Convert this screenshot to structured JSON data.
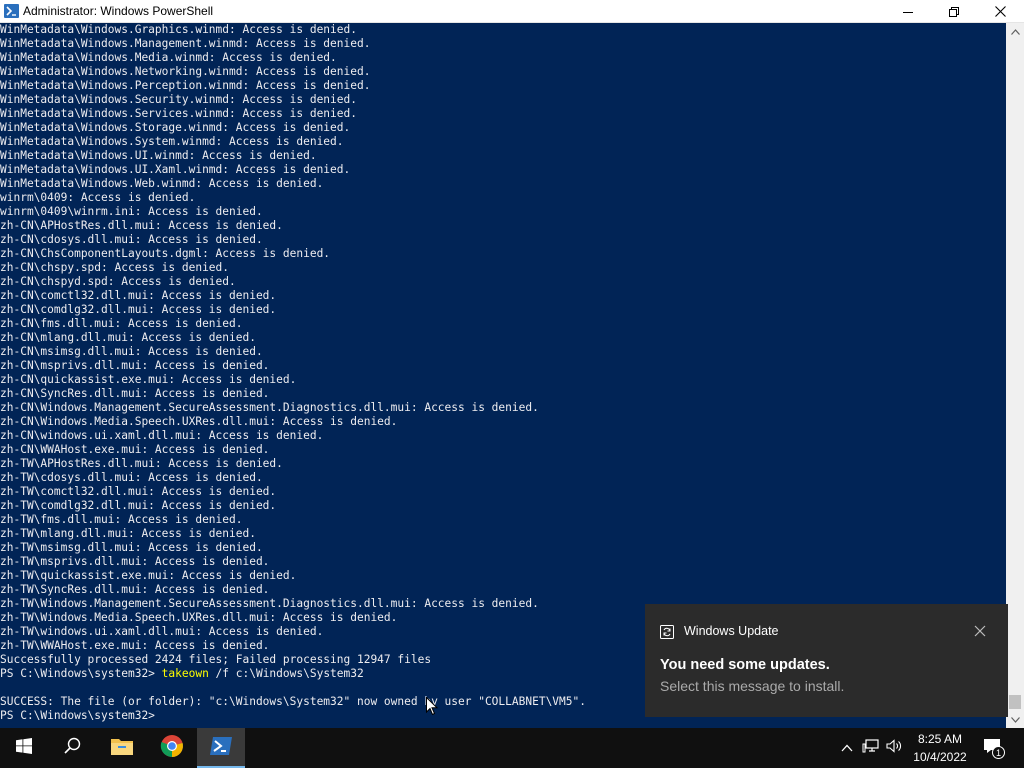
{
  "window": {
    "title": "Administrator: Windows PowerShell",
    "minimize_icon": "minimize-icon",
    "maximize_icon": "restore-icon",
    "close_icon": "close-icon"
  },
  "console": {
    "background": "#012456",
    "text_color": "#eeedf0",
    "command_color": "#ffff00",
    "lines": [
      "WinMetadata\\Windows.Graphics.winmd: Access is denied.",
      "WinMetadata\\Windows.Management.winmd: Access is denied.",
      "WinMetadata\\Windows.Media.winmd: Access is denied.",
      "WinMetadata\\Windows.Networking.winmd: Access is denied.",
      "WinMetadata\\Windows.Perception.winmd: Access is denied.",
      "WinMetadata\\Windows.Security.winmd: Access is denied.",
      "WinMetadata\\Windows.Services.winmd: Access is denied.",
      "WinMetadata\\Windows.Storage.winmd: Access is denied.",
      "WinMetadata\\Windows.System.winmd: Access is denied.",
      "WinMetadata\\Windows.UI.winmd: Access is denied.",
      "WinMetadata\\Windows.UI.Xaml.winmd: Access is denied.",
      "WinMetadata\\Windows.Web.winmd: Access is denied.",
      "winrm\\0409: Access is denied.",
      "winrm\\0409\\winrm.ini: Access is denied.",
      "zh-CN\\APHostRes.dll.mui: Access is denied.",
      "zh-CN\\cdosys.dll.mui: Access is denied.",
      "zh-CN\\ChsComponentLayouts.dgml: Access is denied.",
      "zh-CN\\chspy.spd: Access is denied.",
      "zh-CN\\chspyd.spd: Access is denied.",
      "zh-CN\\comctl32.dll.mui: Access is denied.",
      "zh-CN\\comdlg32.dll.mui: Access is denied.",
      "zh-CN\\fms.dll.mui: Access is denied.",
      "zh-CN\\mlang.dll.mui: Access is denied.",
      "zh-CN\\msimsg.dll.mui: Access is denied.",
      "zh-CN\\msprivs.dll.mui: Access is denied.",
      "zh-CN\\quickassist.exe.mui: Access is denied.",
      "zh-CN\\SyncRes.dll.mui: Access is denied.",
      "zh-CN\\Windows.Management.SecureAssessment.Diagnostics.dll.mui: Access is denied.",
      "zh-CN\\Windows.Media.Speech.UXRes.dll.mui: Access is denied.",
      "zh-CN\\windows.ui.xaml.dll.mui: Access is denied.",
      "zh-CN\\WWAHost.exe.mui: Access is denied.",
      "zh-TW\\APHostRes.dll.mui: Access is denied.",
      "zh-TW\\cdosys.dll.mui: Access is denied.",
      "zh-TW\\comctl32.dll.mui: Access is denied.",
      "zh-TW\\comdlg32.dll.mui: Access is denied.",
      "zh-TW\\fms.dll.mui: Access is denied.",
      "zh-TW\\mlang.dll.mui: Access is denied.",
      "zh-TW\\msimsg.dll.mui: Access is denied.",
      "zh-TW\\msprivs.dll.mui: Access is denied.",
      "zh-TW\\quickassist.exe.mui: Access is denied.",
      "zh-TW\\SyncRes.dll.mui: Access is denied.",
      "zh-TW\\Windows.Management.SecureAssessment.Diagnostics.dll.mui: Access is denied.",
      "zh-TW\\Windows.Media.Speech.UXRes.dll.mui: Access is denied.",
      "zh-TW\\windows.ui.xaml.dll.mui: Access is denied.",
      "zh-TW\\WWAHost.exe.mui: Access is denied.",
      "Successfully processed 2424 files; Failed processing 12947 files"
    ],
    "command_line": {
      "prompt": "PS C:\\Windows\\system32> ",
      "command": "takeown",
      "args": " /f c:\\Windows\\System32"
    },
    "success_line": "SUCCESS: The file (or folder): \"c:\\Windows\\System32\" now owned by user \"COLLABNET\\VM5\".",
    "current_prompt": "PS C:\\Windows\\system32>"
  },
  "notification": {
    "source": "Windows Update",
    "source_icon": "windows-update-icon",
    "headline": "You need some updates.",
    "body": "Select this message to install.",
    "close_icon": "close-icon"
  },
  "taskbar": {
    "items": [
      {
        "name": "start-button",
        "icon": "windows-logo-icon"
      },
      {
        "name": "search-button",
        "icon": "search-icon"
      },
      {
        "name": "file-explorer",
        "icon": "folder-icon"
      },
      {
        "name": "chrome",
        "icon": "chrome-icon"
      },
      {
        "name": "powershell",
        "icon": "powershell-icon",
        "active": true
      }
    ],
    "tray_icons": [
      "chevron-up-icon",
      "network-icon",
      "volume-icon"
    ],
    "time": "8:25 AM",
    "date": "10/4/2022",
    "notification_count": "1"
  }
}
